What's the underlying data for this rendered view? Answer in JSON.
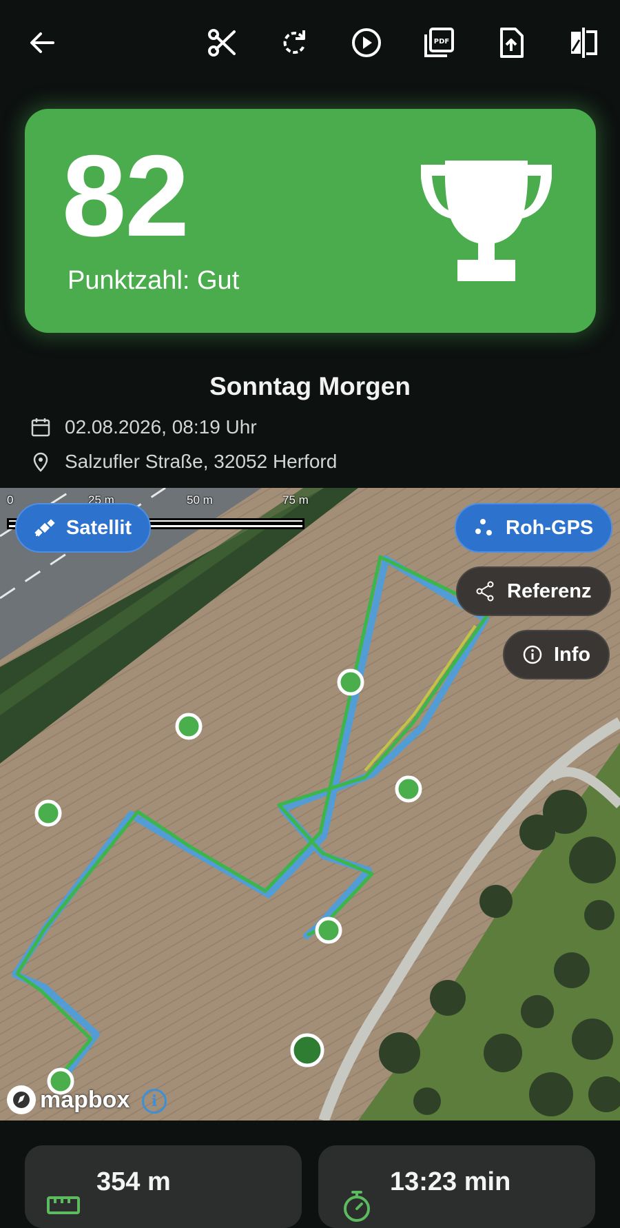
{
  "toolbar": {
    "icons": [
      "back-arrow-icon",
      "scissors-icon",
      "refresh-icon",
      "play-icon",
      "pdf-icon",
      "upload-icon",
      "compare-icon"
    ]
  },
  "score": {
    "value": "82",
    "label": "Punktzahl: Gut",
    "icon": "trophy-icon",
    "color": "#4bac4d"
  },
  "session": {
    "title": "Sonntag Morgen",
    "datetime": "02.08.2026, 08:19 Uhr",
    "location": "Salzufler Straße, 32052 Herford"
  },
  "map": {
    "scale": {
      "labels": [
        "0",
        "25 m",
        "50 m",
        "75 m"
      ]
    },
    "buttons": {
      "satellite": "Satellit",
      "raw_gps": "Roh-GPS",
      "reference": "Referenz",
      "info": "Info"
    },
    "attribution": "mapbox",
    "attribution_info": "i",
    "colors": {
      "raw_track": "#4a9ee0",
      "ref_track": "#3cb54a",
      "marker": "#4aae4c",
      "marker_end": "#2e7d32",
      "accent": "#2d72cc"
    }
  },
  "stats": {
    "distance": "354 m",
    "duration": "13:23 min"
  }
}
